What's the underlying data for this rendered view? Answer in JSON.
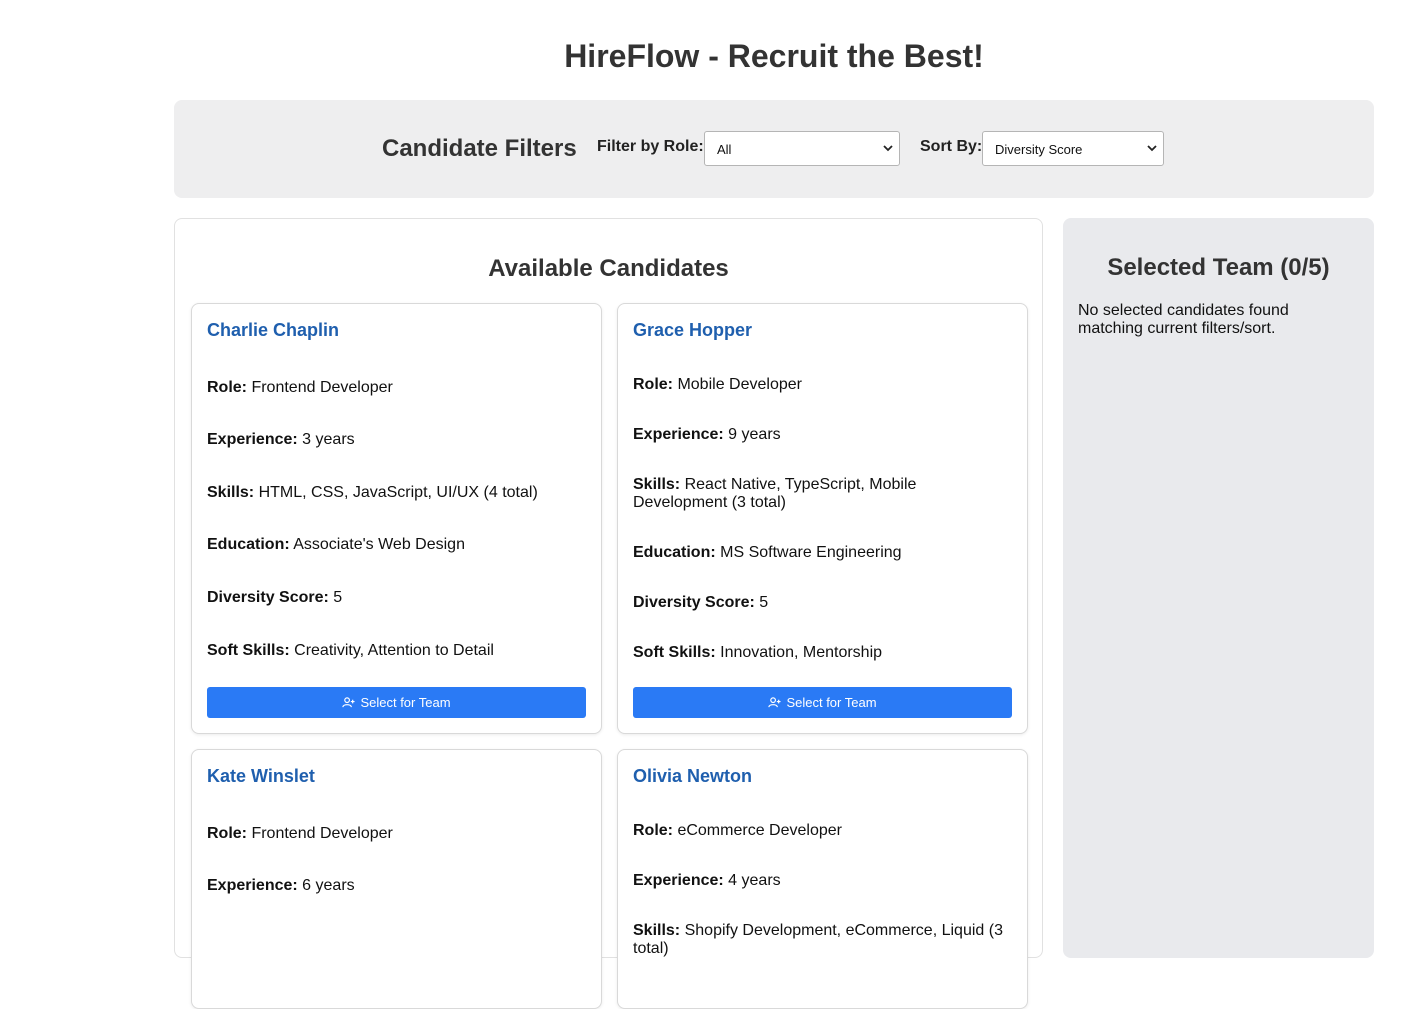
{
  "header": {
    "title": "HireFlow - Recruit the Best!"
  },
  "filters": {
    "title": "Candidate Filters",
    "role_label": "Filter by Role:",
    "role_value": "All",
    "sort_label": "Sort By:",
    "sort_value": "Diversity Score"
  },
  "candidates_panel": {
    "title": "Available Candidates",
    "button_label": "Select for Team",
    "field_labels": {
      "role": "Role:",
      "experience": "Experience:",
      "skills": "Skills:",
      "education": "Education:",
      "diversity": "Diversity Score:",
      "soft_skills": "Soft Skills:"
    },
    "cards": [
      {
        "name": "Charlie Chaplin",
        "role": "Frontend Developer",
        "experience": "3 years",
        "skills": "HTML, CSS, JavaScript, UI/UX (4 total)",
        "education": "Associate's Web Design",
        "diversity": "5",
        "soft_skills": "Creativity, Attention to Detail"
      },
      {
        "name": "Grace Hopper",
        "role": "Mobile Developer",
        "experience": "9 years",
        "skills": "React Native, TypeScript, Mobile Development (3 total)",
        "education": "MS Software Engineering",
        "diversity": "5",
        "soft_skills": "Innovation, Mentorship"
      },
      {
        "name": "Kate Winslet",
        "role": "Frontend Developer",
        "experience": "6 years"
      },
      {
        "name": "Olivia Newton",
        "role": "eCommerce Developer",
        "experience": "4 years",
        "skills": "Shopify Development, eCommerce, Liquid (3 total)"
      }
    ]
  },
  "team_panel": {
    "title": "Selected Team (0/5)",
    "empty_message": "No selected candidates found matching current filters/sort."
  },
  "colors": {
    "accent": "#2a7af5",
    "name_link": "#1f5fae",
    "filters_bg": "#eeeeef",
    "team_bg": "#e9eaed"
  },
  "icons": {
    "button_icon": "user-plus-icon",
    "select_chevron": "chevron-down-icon"
  }
}
